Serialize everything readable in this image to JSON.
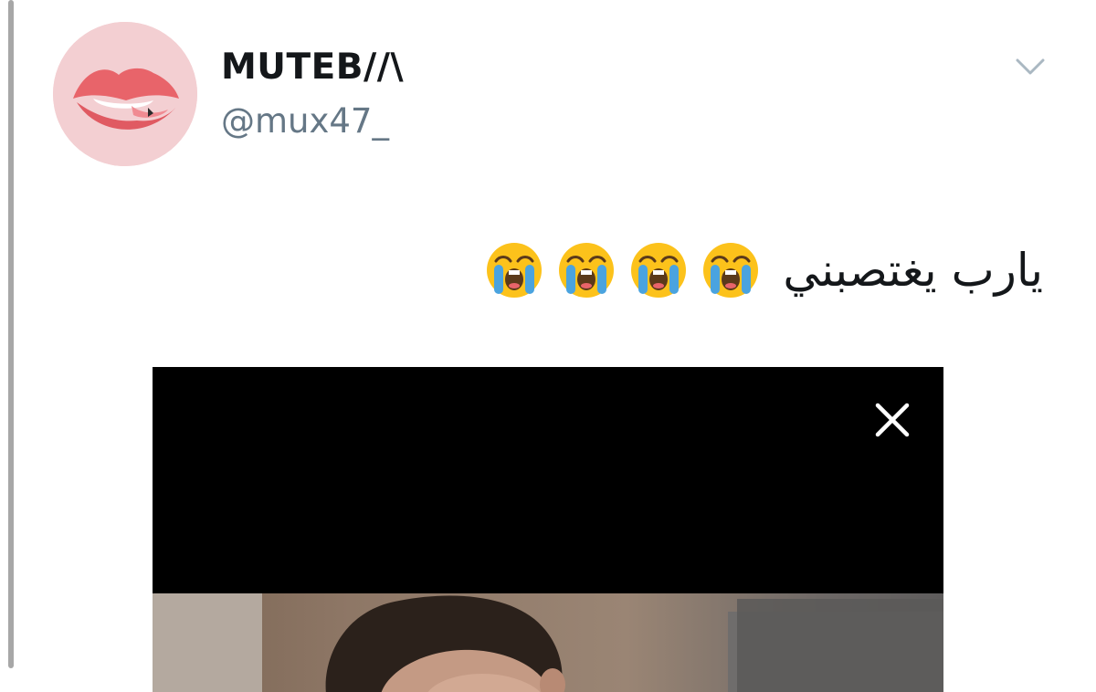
{
  "tweet": {
    "author": {
      "display_name": "MUTEB//\\",
      "handle": "@mux47_",
      "avatar_icon": "lips-icon"
    },
    "text": "يارب يغتصبني",
    "emojis": [
      "loudly-crying-face-icon",
      "loudly-crying-face-icon",
      "loudly-crying-face-icon",
      "loudly-crying-face-icon"
    ],
    "menu_icon": "chevron-down-icon",
    "media": {
      "close_icon": "close-icon",
      "background_color": "#000000"
    }
  },
  "colors": {
    "name": "#14171a",
    "handle": "#657786",
    "thread_line": "#a7a7a7",
    "avatar_bg": "#f3cfd2",
    "lips": "#e8646a"
  }
}
